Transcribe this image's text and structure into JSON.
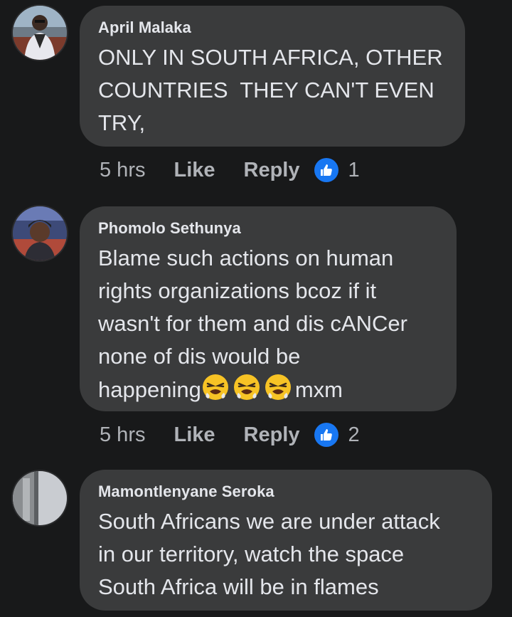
{
  "comments": [
    {
      "author": "April Malaka",
      "text": "ONLY IN SOUTH AFRICA, OTHER\nCOUNTRIES  THEY CAN'T EVEN\nTRY,",
      "time": "5 hrs",
      "like_label": "Like",
      "reply_label": "Reply",
      "reaction_icon": "like-icon",
      "reaction_count": "1"
    },
    {
      "author": "Phomolo Sethunya",
      "text_main": "Blame such actions on human\nrights organizations bcoz if it\nwasn't for them and dis cANCer\nnone of dis would be\nhappening",
      "text_emojis": [
        "tired-face",
        "tired-face",
        "tired-face"
      ],
      "text_tail": "mxm",
      "time": "5 hrs",
      "like_label": "Like",
      "reply_label": "Reply",
      "reaction_icon": "like-icon",
      "reaction_count": "2"
    },
    {
      "author": "Mamontlenyane Seroka",
      "text": "South Africans we are under attack\nin our territory, watch the space\nSouth Africa will be in flames"
    }
  ],
  "colors": {
    "background": "#18191a",
    "bubble": "#3a3b3c",
    "primary_text": "#e4e6eb",
    "secondary_text": "#b0b3b8",
    "like_blue": "#1877f2"
  }
}
